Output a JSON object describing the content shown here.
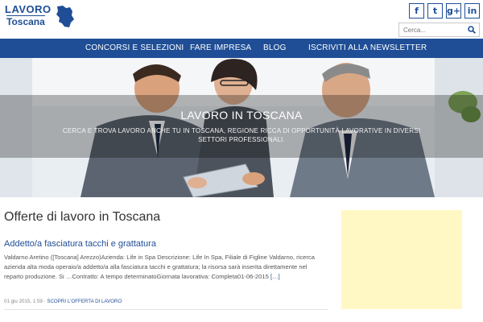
{
  "header": {
    "logo": {
      "line1": "LAVORO",
      "line2": "Toscana"
    },
    "social": [
      {
        "icon": "facebook-icon",
        "glyph": "f"
      },
      {
        "icon": "twitter-icon",
        "glyph": "t"
      },
      {
        "icon": "google-plus-icon",
        "glyph": "g+"
      },
      {
        "icon": "linkedin-icon",
        "glyph": "in"
      }
    ],
    "search": {
      "placeholder": "Cerca...",
      "icon": "search-icon"
    }
  },
  "nav": {
    "items": [
      {
        "label": "CONCORSI E SELEZIONI"
      },
      {
        "label": "FARE IMPRESA"
      },
      {
        "label": "BLOG"
      },
      {
        "label": "ISCRIVITI ALLA NEWSLETTER"
      }
    ]
  },
  "hero": {
    "title": "LAVORO IN TOSCANA",
    "subtitle": "CERCA E TROVA LAVORO ANCHE TU IN TOSCANA, REGIONE RICCA DI OPPORTUNITÀ LAVORATIVE IN DIVERSI SETTORI PROFESSIONALI."
  },
  "main": {
    "page_title": "Offerte di lavoro in Toscana",
    "post": {
      "title": "Addetto/a fasciatura tacchi e grattatura",
      "excerpt": "Valdarno Aretino ([Toscana] Arezzo)Azienda: Life in Spa Descrizione: Life In Spa, Filiale di Figline Valdarno, ricerca azienda alta moda operaio/a addetto/a alla fasciatura tacchi e grattatura; la risorsa sarà inserita direttamente nel reparto produzione. Si …Contratto: A tempo determinatoGiornata lavorativa: Completa01-06-2015",
      "more": "[…]",
      "meta_date": "01 giu 2015, 1:59",
      "meta_sep": " · ",
      "meta_link": "SCOPRI L'OFFERTA DI LAVORO"
    }
  },
  "colors": {
    "brand_blue": "#1f4e96",
    "sidebar_box": "#fff8c4"
  }
}
